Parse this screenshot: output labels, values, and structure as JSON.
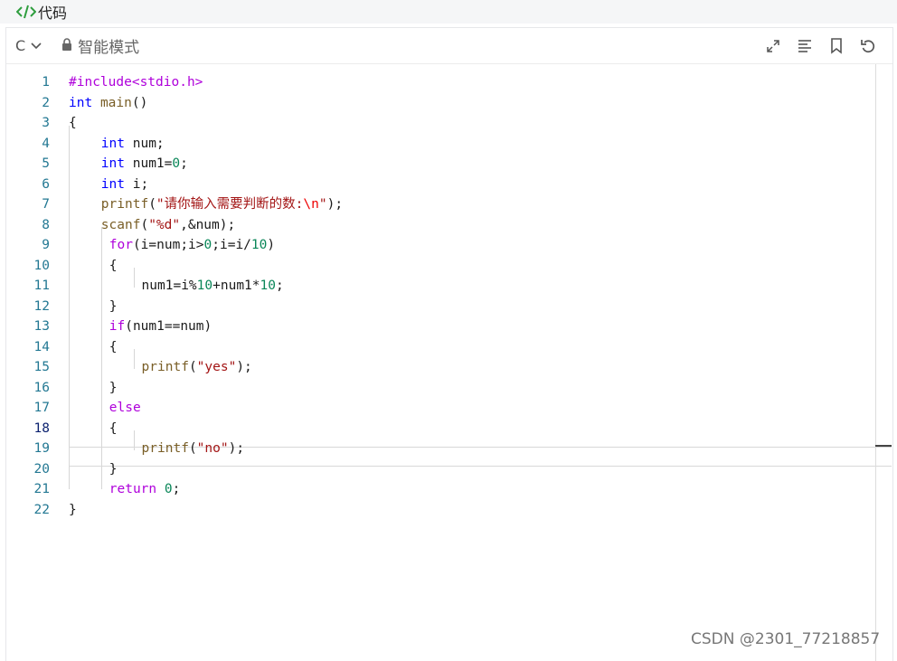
{
  "title": "代码",
  "toolbar": {
    "language": "C",
    "mode": "智能模式",
    "icons": [
      "expand-icon",
      "format-icon",
      "bookmark-icon",
      "undo-icon"
    ]
  },
  "code": {
    "active_line": 18,
    "lines": [
      {
        "n": "1",
        "indent": 0,
        "tokens": [
          [
            "pp",
            "#include<stdio.h>"
          ]
        ]
      },
      {
        "n": "2",
        "indent": 0,
        "tokens": [
          [
            "kw",
            "int"
          ],
          [
            "",
            ""
          ],
          [
            "",
            ""
          ],
          [
            "",
            " "
          ],
          [
            "fn",
            "main"
          ],
          [
            "",
            "()"
          ]
        ]
      },
      {
        "n": "3",
        "indent": 0,
        "tokens": [
          [
            "",
            "{"
          ]
        ]
      },
      {
        "n": "4",
        "indent": 4,
        "tokens": [
          [
            "kw",
            "int"
          ],
          [
            "",
            ""
          ],
          [
            "",
            ""
          ],
          [
            "",
            " num;"
          ]
        ]
      },
      {
        "n": "5",
        "indent": 4,
        "tokens": [
          [
            "kw",
            "int"
          ],
          [
            "",
            " num1="
          ],
          [
            "num",
            "0"
          ],
          [
            "",
            ";"
          ]
        ]
      },
      {
        "n": "6",
        "indent": 4,
        "tokens": [
          [
            "kw",
            "int"
          ],
          [
            "",
            " i;"
          ]
        ]
      },
      {
        "n": "7",
        "indent": 4,
        "tokens": [
          [
            "fn",
            "printf"
          ],
          [
            "",
            "("
          ],
          [
            "str",
            "\"请你输入需要判断的数:"
          ],
          [
            "esc",
            "\\n"
          ],
          [
            "str",
            "\""
          ],
          [
            "",
            ");"
          ]
        ]
      },
      {
        "n": "8",
        "indent": 4,
        "tokens": [
          [
            "fn",
            "scanf"
          ],
          [
            "",
            "("
          ],
          [
            "str",
            "\"%d\""
          ],
          [
            "",
            ",&num);"
          ]
        ]
      },
      {
        "n": "9",
        "indent": 5,
        "tokens": [
          [
            "ctl",
            "for"
          ],
          [
            "",
            "(i=num;i>"
          ],
          [
            "num",
            "0"
          ],
          [
            "",
            ";i=i/"
          ],
          [
            "num",
            "10"
          ],
          [
            "",
            ")"
          ]
        ]
      },
      {
        "n": "10",
        "indent": 5,
        "tokens": [
          [
            "",
            "{"
          ]
        ]
      },
      {
        "n": "11",
        "indent": 9,
        "tokens": [
          [
            "",
            "num1=i%"
          ],
          [
            "num",
            "10"
          ],
          [
            "",
            "+num1*"
          ],
          [
            "num",
            "10"
          ],
          [
            "",
            ";"
          ]
        ]
      },
      {
        "n": "12",
        "indent": 5,
        "tokens": [
          [
            "",
            "}"
          ]
        ]
      },
      {
        "n": "13",
        "indent": 5,
        "tokens": [
          [
            "ctl",
            "if"
          ],
          [
            "",
            "(num1==num)"
          ]
        ]
      },
      {
        "n": "14",
        "indent": 5,
        "tokens": [
          [
            "",
            "{"
          ]
        ]
      },
      {
        "n": "15",
        "indent": 9,
        "tokens": [
          [
            "fn",
            "printf"
          ],
          [
            "",
            "("
          ],
          [
            "str",
            "\"yes\""
          ],
          [
            "",
            ");"
          ]
        ]
      },
      {
        "n": "16",
        "indent": 5,
        "tokens": [
          [
            "",
            "}"
          ]
        ]
      },
      {
        "n": "17",
        "indent": 5,
        "tokens": [
          [
            "ctl",
            "else"
          ]
        ]
      },
      {
        "n": "18",
        "indent": 5,
        "tokens": [
          [
            "",
            "{"
          ]
        ]
      },
      {
        "n": "19",
        "indent": 9,
        "tokens": [
          [
            "fn",
            "printf"
          ],
          [
            "",
            "("
          ],
          [
            "str",
            "\"no\""
          ],
          [
            "",
            ");"
          ]
        ]
      },
      {
        "n": "20",
        "indent": 5,
        "tokens": [
          [
            "",
            "}"
          ]
        ]
      },
      {
        "n": "21",
        "indent": 5,
        "tokens": [
          [
            "ctl",
            "return"
          ],
          [
            "",
            " "
          ],
          [
            "num",
            "0"
          ],
          [
            "",
            ";"
          ]
        ]
      },
      {
        "n": "22",
        "indent": 0,
        "tokens": [
          [
            "",
            "}"
          ]
        ]
      }
    ]
  },
  "watermark": "CSDN @2301_77218857"
}
